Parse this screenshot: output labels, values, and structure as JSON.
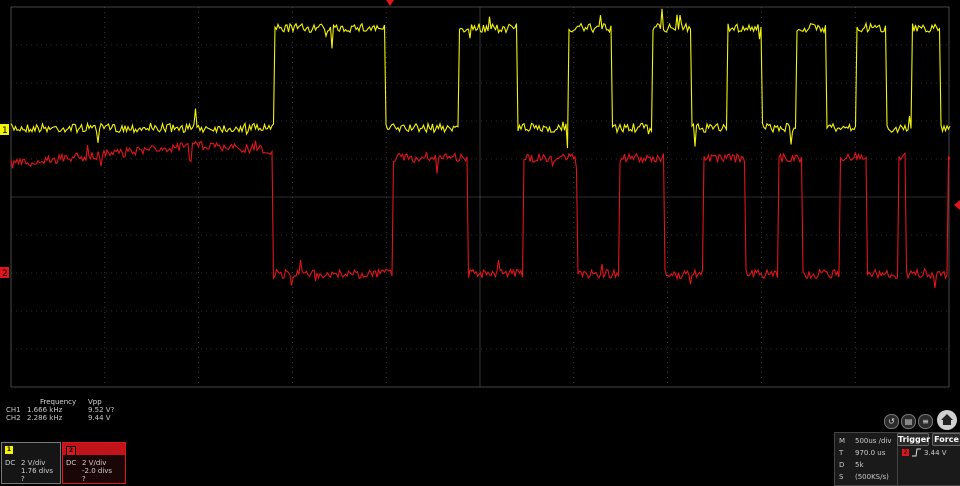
{
  "colors": {
    "ch1": "#f2f20a",
    "ch2": "#e0141b",
    "grid": "#5a5a5a",
    "panel_bg": "#151515"
  },
  "grid": {
    "h_divs": 10,
    "v_divs": 10
  },
  "channels": [
    {
      "id": "1",
      "coupling": "DC",
      "scale": "2 V/div",
      "offset": "1.76 divs",
      "extra": "?",
      "marker": "1",
      "color": "#f2f20a"
    },
    {
      "id": "2",
      "coupling": "DC",
      "scale": "2 V/div",
      "offset": "-2.0 divs",
      "extra": "?",
      "marker": "2",
      "color": "#e0141b"
    }
  ],
  "measurements": {
    "headers": [
      "Frequency",
      "Vpp"
    ],
    "rows": [
      {
        "label": "CH1",
        "frequency": "1.666 kHz",
        "vpp": "9.52 V?"
      },
      {
        "label": "CH2",
        "frequency": "2.286 kHz",
        "vpp": "9.44 V"
      }
    ]
  },
  "timebase": {
    "rows": [
      {
        "key": "M",
        "value": "500us /div"
      },
      {
        "key": "T",
        "value": "970.0 us"
      },
      {
        "key": "D",
        "value": "5k"
      },
      {
        "key": "S",
        "value": "(500KS/s)"
      }
    ]
  },
  "trigger": {
    "button_label": "Trigger",
    "force_label": "Force",
    "source": "2",
    "level": "3.44 V"
  },
  "toolbar_icons": [
    "undo-icon",
    "save-icon",
    "menu-icon",
    "home-icon"
  ]
}
